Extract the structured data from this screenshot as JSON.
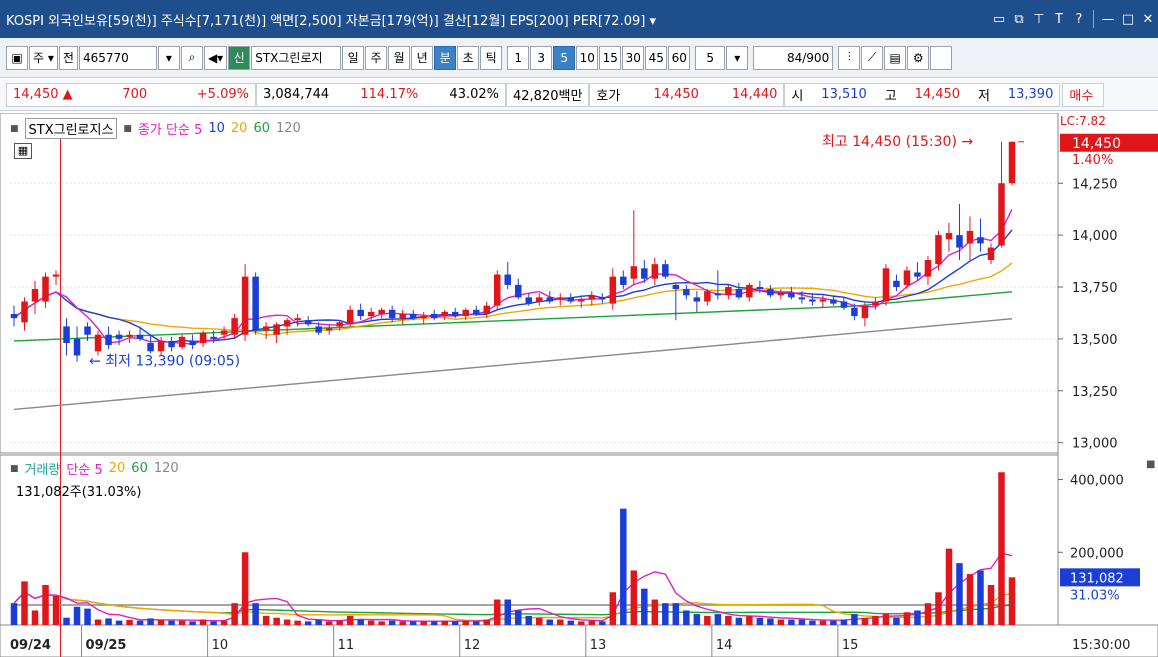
{
  "titlebar": {
    "text": "KOSPI 외국인보유[59(천)] 주식수[7,171(천)] 액면[2,500] 자본금[179(억)] 결산[12월] EPS[200] PER[72.09] ▾",
    "icons": [
      "window-icon",
      "copy-icon",
      "pin-icon",
      "font-icon",
      "help-icon",
      "minimize-icon",
      "maximize-icon",
      "close-icon"
    ]
  },
  "toolbar": {
    "code_label": "주",
    "all_label": "전",
    "code_value": "465770",
    "stock_name": "STX그린로지",
    "period_tabs": [
      "일",
      "주",
      "월",
      "년",
      "분",
      "초",
      "틱"
    ],
    "active_tab": "분",
    "interval_buttons": [
      "1",
      "3",
      "5",
      "10",
      "15",
      "30",
      "45",
      "60"
    ],
    "active_interval": "5",
    "interval_select": "5",
    "count_value": "84",
    "count_total": "/900"
  },
  "pricebar": {
    "price": "14,450",
    "arrow": "▲",
    "change": "700",
    "change_pct": "+5.09%",
    "volume": "3,084,744",
    "vol_ratio": "114.17%",
    "turnover": "43.02%",
    "amount": "42,820백만",
    "hoga_label": "호가",
    "ask": "14,450",
    "bid": "14,440",
    "open_label": "시",
    "open": "13,510",
    "high_label": "고",
    "high": "14,450",
    "low_label": "저",
    "low": "13,390",
    "buy_label": "매수"
  },
  "legend_price": {
    "stock": "STX그린로지스",
    "ma_label": "종가 단순",
    "periods": [
      "5",
      "10",
      "20",
      "60",
      "120"
    ]
  },
  "legend_volume": {
    "label": "거래량",
    "ma_label": "단순",
    "periods": [
      "5",
      "20",
      "60",
      "120"
    ],
    "current": "131,082주(31.03%)"
  },
  "annotations": {
    "high": "최고 14,450 (15:30)",
    "low": "최저 13,390 (09:05)"
  },
  "right_axis": {
    "price_badge": "14,450",
    "price_pct": "1.40%",
    "top_partial": "LC:7.82",
    "price_ticks": [
      "14,250",
      "14,000",
      "13,750",
      "13,500",
      "13,250",
      "13,000"
    ],
    "volume_ticks": [
      "400,000",
      "200,000"
    ],
    "volume_badge": "131,082",
    "volume_pct": "31.03%",
    "time": "15:30:00"
  },
  "x_axis": {
    "labels": [
      "09/24",
      "09/25",
      "10",
      "11",
      "12",
      "13",
      "14",
      "15"
    ]
  },
  "colors": {
    "up": "#e0161b",
    "down": "#1b3fd6",
    "ma5": "#e020c8",
    "ma10": "#1b3fd6",
    "ma20": "#f0a800",
    "ma60": "#1aa33a",
    "ma120": "#888888",
    "titlebar": "#1f4e8c"
  },
  "chart_data": {
    "type": "candlestick",
    "y_range": [
      12950,
      14550
    ],
    "volume_range": [
      0,
      440000
    ],
    "candles": [
      {
        "o": 13620,
        "h": 13660,
        "l": 13560,
        "c": 13600,
        "v": 60000
      },
      {
        "o": 13580,
        "h": 13700,
        "l": 13540,
        "c": 13680,
        "v": 120000
      },
      {
        "o": 13680,
        "h": 13780,
        "l": 13620,
        "c": 13740,
        "v": 40000
      },
      {
        "o": 13680,
        "h": 13820,
        "l": 13650,
        "c": 13800,
        "v": 110000
      },
      {
        "o": 13800,
        "h": 13830,
        "l": 13760,
        "c": 13810,
        "v": 80000
      },
      {
        "o": 13560,
        "h": 13600,
        "l": 13420,
        "c": 13480,
        "v": 20000
      },
      {
        "o": 13500,
        "h": 13560,
        "l": 13390,
        "c": 13420,
        "v": 50000
      },
      {
        "o": 13560,
        "h": 13580,
        "l": 13490,
        "c": 13520,
        "v": 45000
      },
      {
        "o": 13440,
        "h": 13540,
        "l": 13420,
        "c": 13520,
        "v": 15000
      },
      {
        "o": 13520,
        "h": 13560,
        "l": 13450,
        "c": 13470,
        "v": 18000
      },
      {
        "o": 13520,
        "h": 13540,
        "l": 13470,
        "c": 13500,
        "v": 12000
      },
      {
        "o": 13510,
        "h": 13540,
        "l": 13480,
        "c": 13520,
        "v": 14000
      },
      {
        "o": 13520,
        "h": 13560,
        "l": 13490,
        "c": 13500,
        "v": 12000
      },
      {
        "o": 13480,
        "h": 13520,
        "l": 13430,
        "c": 13440,
        "v": 18000
      },
      {
        "o": 13440,
        "h": 13510,
        "l": 13420,
        "c": 13490,
        "v": 14000
      },
      {
        "o": 13490,
        "h": 13510,
        "l": 13440,
        "c": 13460,
        "v": 12000
      },
      {
        "o": 13460,
        "h": 13520,
        "l": 13450,
        "c": 13510,
        "v": 12000
      },
      {
        "o": 13490,
        "h": 13520,
        "l": 13450,
        "c": 13470,
        "v": 10000
      },
      {
        "o": 13480,
        "h": 13540,
        "l": 13460,
        "c": 13530,
        "v": 15000
      },
      {
        "o": 13510,
        "h": 13540,
        "l": 13480,
        "c": 13500,
        "v": 10000
      },
      {
        "o": 13520,
        "h": 13560,
        "l": 13500,
        "c": 13540,
        "v": 12000
      },
      {
        "o": 13520,
        "h": 13620,
        "l": 13500,
        "c": 13600,
        "v": 60000
      },
      {
        "o": 13520,
        "h": 13860,
        "l": 13490,
        "c": 13800,
        "v": 200000
      },
      {
        "o": 13800,
        "h": 13820,
        "l": 13520,
        "c": 13540,
        "v": 60000
      },
      {
        "o": 13540,
        "h": 13580,
        "l": 13500,
        "c": 13560,
        "v": 25000
      },
      {
        "o": 13520,
        "h": 13580,
        "l": 13480,
        "c": 13570,
        "v": 20000
      },
      {
        "o": 13560,
        "h": 13600,
        "l": 13520,
        "c": 13590,
        "v": 15000
      },
      {
        "o": 13590,
        "h": 13620,
        "l": 13560,
        "c": 13600,
        "v": 12000
      },
      {
        "o": 13590,
        "h": 13610,
        "l": 13560,
        "c": 13570,
        "v": 10000
      },
      {
        "o": 13560,
        "h": 13580,
        "l": 13520,
        "c": 13530,
        "v": 15000
      },
      {
        "o": 13540,
        "h": 13570,
        "l": 13520,
        "c": 13550,
        "v": 10000
      },
      {
        "o": 13560,
        "h": 13590,
        "l": 13540,
        "c": 13580,
        "v": 12000
      },
      {
        "o": 13570,
        "h": 13660,
        "l": 13560,
        "c": 13640,
        "v": 25000
      },
      {
        "o": 13640,
        "h": 13670,
        "l": 13590,
        "c": 13610,
        "v": 15000
      },
      {
        "o": 13610,
        "h": 13650,
        "l": 13590,
        "c": 13630,
        "v": 12000
      },
      {
        "o": 13620,
        "h": 13650,
        "l": 13600,
        "c": 13640,
        "v": 10000
      },
      {
        "o": 13640,
        "h": 13660,
        "l": 13580,
        "c": 13600,
        "v": 12000
      },
      {
        "o": 13600,
        "h": 13640,
        "l": 13570,
        "c": 13620,
        "v": 10000
      },
      {
        "o": 13620,
        "h": 13640,
        "l": 13590,
        "c": 13600,
        "v": 10000
      },
      {
        "o": 13600,
        "h": 13630,
        "l": 13570,
        "c": 13610,
        "v": 10000
      },
      {
        "o": 13620,
        "h": 13640,
        "l": 13590,
        "c": 13600,
        "v": 10000
      },
      {
        "o": 13610,
        "h": 13640,
        "l": 13590,
        "c": 13630,
        "v": 12000
      },
      {
        "o": 13630,
        "h": 13650,
        "l": 13600,
        "c": 13610,
        "v": 10000
      },
      {
        "o": 13610,
        "h": 13650,
        "l": 13590,
        "c": 13640,
        "v": 12000
      },
      {
        "o": 13640,
        "h": 13660,
        "l": 13610,
        "c": 13620,
        "v": 10000
      },
      {
        "o": 13620,
        "h": 13680,
        "l": 13600,
        "c": 13660,
        "v": 15000
      },
      {
        "o": 13660,
        "h": 13830,
        "l": 13640,
        "c": 13810,
        "v": 70000
      },
      {
        "o": 13810,
        "h": 13870,
        "l": 13740,
        "c": 13760,
        "v": 70000
      },
      {
        "o": 13760,
        "h": 13790,
        "l": 13690,
        "c": 13700,
        "v": 40000
      },
      {
        "o": 13700,
        "h": 13720,
        "l": 13660,
        "c": 13670,
        "v": 25000
      },
      {
        "o": 13680,
        "h": 13720,
        "l": 13660,
        "c": 13700,
        "v": 20000
      },
      {
        "o": 13700,
        "h": 13730,
        "l": 13670,
        "c": 13680,
        "v": 15000
      },
      {
        "o": 13690,
        "h": 13720,
        "l": 13660,
        "c": 13700,
        "v": 15000
      },
      {
        "o": 13700,
        "h": 13720,
        "l": 13670,
        "c": 13680,
        "v": 12000
      },
      {
        "o": 13680,
        "h": 13710,
        "l": 13650,
        "c": 13690,
        "v": 10000
      },
      {
        "o": 13690,
        "h": 13730,
        "l": 13660,
        "c": 13710,
        "v": 12000
      },
      {
        "o": 13700,
        "h": 13720,
        "l": 13670,
        "c": 13690,
        "v": 10000
      },
      {
        "o": 13670,
        "h": 13840,
        "l": 13640,
        "c": 13800,
        "v": 90000
      },
      {
        "o": 13800,
        "h": 13830,
        "l": 13740,
        "c": 13760,
        "v": 320000
      },
      {
        "o": 13790,
        "h": 14120,
        "l": 13760,
        "c": 13850,
        "v": 150000
      },
      {
        "o": 13840,
        "h": 13880,
        "l": 13770,
        "c": 13790,
        "v": 100000
      },
      {
        "o": 13790,
        "h": 13890,
        "l": 13760,
        "c": 13860,
        "v": 70000
      },
      {
        "o": 13860,
        "h": 13880,
        "l": 13790,
        "c": 13800,
        "v": 60000
      },
      {
        "o": 13760,
        "h": 13770,
        "l": 13590,
        "c": 13740,
        "v": 60000
      },
      {
        "o": 13740,
        "h": 13760,
        "l": 13690,
        "c": 13710,
        "v": 40000
      },
      {
        "o": 13700,
        "h": 13730,
        "l": 13630,
        "c": 13680,
        "v": 30000
      },
      {
        "o": 13680,
        "h": 13740,
        "l": 13660,
        "c": 13730,
        "v": 25000
      },
      {
        "o": 13720,
        "h": 13830,
        "l": 13690,
        "c": 13710,
        "v": 30000
      },
      {
        "o": 13710,
        "h": 13760,
        "l": 13690,
        "c": 13750,
        "v": 25000
      },
      {
        "o": 13740,
        "h": 13770,
        "l": 13690,
        "c": 13700,
        "v": 20000
      },
      {
        "o": 13700,
        "h": 13770,
        "l": 13680,
        "c": 13760,
        "v": 25000
      },
      {
        "o": 13750,
        "h": 13780,
        "l": 13720,
        "c": 13740,
        "v": 20000
      },
      {
        "o": 13740,
        "h": 13760,
        "l": 13700,
        "c": 13710,
        "v": 18000
      },
      {
        "o": 13710,
        "h": 13740,
        "l": 13690,
        "c": 13720,
        "v": 15000
      },
      {
        "o": 13720,
        "h": 13750,
        "l": 13690,
        "c": 13700,
        "v": 15000
      },
      {
        "o": 13700,
        "h": 13730,
        "l": 13670,
        "c": 13690,
        "v": 15000
      },
      {
        "o": 13690,
        "h": 13720,
        "l": 13660,
        "c": 13680,
        "v": 12000
      },
      {
        "o": 13680,
        "h": 13710,
        "l": 13650,
        "c": 13690,
        "v": 12000
      },
      {
        "o": 13690,
        "h": 13710,
        "l": 13660,
        "c": 13670,
        "v": 12000
      },
      {
        "o": 13680,
        "h": 13700,
        "l": 13640,
        "c": 13650,
        "v": 15000
      },
      {
        "o": 13650,
        "h": 13670,
        "l": 13590,
        "c": 13610,
        "v": 30000
      },
      {
        "o": 13600,
        "h": 13680,
        "l": 13560,
        "c": 13660,
        "v": 20000
      },
      {
        "o": 13660,
        "h": 13700,
        "l": 13640,
        "c": 13680,
        "v": 25000
      },
      {
        "o": 13680,
        "h": 13860,
        "l": 13660,
        "c": 13840,
        "v": 30000
      },
      {
        "o": 13780,
        "h": 13810,
        "l": 13730,
        "c": 13750,
        "v": 20000
      },
      {
        "o": 13760,
        "h": 13850,
        "l": 13740,
        "c": 13830,
        "v": 35000
      },
      {
        "o": 13820,
        "h": 13870,
        "l": 13780,
        "c": 13800,
        "v": 40000
      },
      {
        "o": 13800,
        "h": 13900,
        "l": 13760,
        "c": 13880,
        "v": 60000
      },
      {
        "o": 13860,
        "h": 14020,
        "l": 13830,
        "c": 14000,
        "v": 90000
      },
      {
        "o": 13980,
        "h": 14060,
        "l": 13920,
        "c": 14010,
        "v": 210000
      },
      {
        "o": 14000,
        "h": 14150,
        "l": 13880,
        "c": 13940,
        "v": 170000
      },
      {
        "o": 13960,
        "h": 14090,
        "l": 13880,
        "c": 14020,
        "v": 140000
      },
      {
        "o": 13990,
        "h": 14080,
        "l": 13920,
        "c": 13960,
        "v": 150000
      },
      {
        "o": 13880,
        "h": 13960,
        "l": 13860,
        "c": 13940,
        "v": 110000
      },
      {
        "o": 13950,
        "h": 14450,
        "l": 13940,
        "c": 14250,
        "v": 420000
      },
      {
        "o": 14250,
        "h": 14450,
        "l": 14240,
        "c": 14450,
        "v": 131082
      }
    ]
  }
}
